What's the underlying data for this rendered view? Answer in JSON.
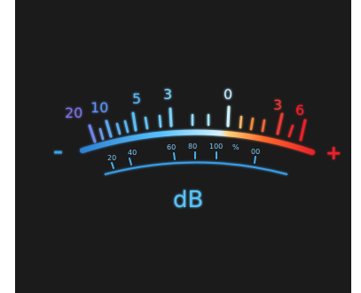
{
  "meter": {
    "top_scale_labels": [
      "20",
      "10",
      "5",
      "3",
      "0",
      "3",
      "6"
    ],
    "bottom_scale_labels": [
      "20",
      "40",
      "60",
      "80",
      "100",
      "%",
      "00"
    ],
    "minus_sign": "–",
    "plus_sign": "+",
    "unit": "dB",
    "colors": {
      "background": "#1b1b1b",
      "blue_light": "#bfe8ff",
      "blue": "#3aa4e8",
      "purple_blue": "#6f6cd8",
      "red": "#e8202a",
      "orange": "#f0a23a"
    }
  }
}
